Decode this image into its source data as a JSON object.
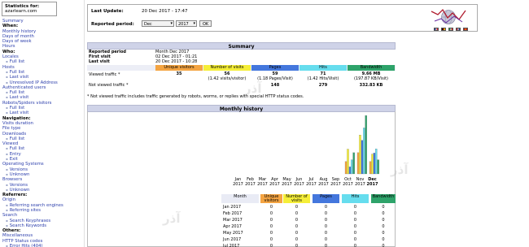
{
  "sidebar": {
    "title": "Statistics for:",
    "site": "azarlearn.com",
    "items": [
      {
        "label": "Summary",
        "kind": "l"
      },
      {
        "label": "When:",
        "kind": "h"
      },
      {
        "label": "Monthly history",
        "kind": "l"
      },
      {
        "label": "Days of month",
        "kind": "l"
      },
      {
        "label": "Days of week",
        "kind": "l"
      },
      {
        "label": "Hours",
        "kind": "l"
      },
      {
        "label": "Who:",
        "kind": "h"
      },
      {
        "label": "Locales",
        "kind": "l"
      },
      {
        "label": "Full list",
        "kind": "sub"
      },
      {
        "label": "Hosts",
        "kind": "l"
      },
      {
        "label": "Full list",
        "kind": "sub"
      },
      {
        "label": "Last visit",
        "kind": "sub"
      },
      {
        "label": "Unresolved IP Address",
        "kind": "sub"
      },
      {
        "label": "Authenticated users",
        "kind": "l"
      },
      {
        "label": "Full list",
        "kind": "sub"
      },
      {
        "label": "Last visit",
        "kind": "sub"
      },
      {
        "label": "Robots/Spiders visitors",
        "kind": "l"
      },
      {
        "label": "Full list",
        "kind": "sub"
      },
      {
        "label": "Last visit",
        "kind": "sub"
      },
      {
        "label": "Navigation:",
        "kind": "h"
      },
      {
        "label": "Visits duration",
        "kind": "l"
      },
      {
        "label": "File type",
        "kind": "l"
      },
      {
        "label": "Downloads",
        "kind": "l"
      },
      {
        "label": "Full list",
        "kind": "sub"
      },
      {
        "label": "Viewed",
        "kind": "l"
      },
      {
        "label": "Full list",
        "kind": "sub"
      },
      {
        "label": "Entry",
        "kind": "sub"
      },
      {
        "label": "Exit",
        "kind": "sub"
      },
      {
        "label": "Operating Systems",
        "kind": "l"
      },
      {
        "label": "Versions",
        "kind": "sub"
      },
      {
        "label": "Unknown",
        "kind": "sub"
      },
      {
        "label": "Browsers",
        "kind": "l"
      },
      {
        "label": "Versions",
        "kind": "sub"
      },
      {
        "label": "Unknown",
        "kind": "sub"
      },
      {
        "label": "Referrers:",
        "kind": "h"
      },
      {
        "label": "Origin",
        "kind": "l"
      },
      {
        "label": "Referring search engines",
        "kind": "sub"
      },
      {
        "label": "Referring sites",
        "kind": "sub"
      },
      {
        "label": "Search",
        "kind": "l"
      },
      {
        "label": "Search Keyphrases",
        "kind": "sub"
      },
      {
        "label": "Search Keywords",
        "kind": "sub"
      },
      {
        "label": "Others:",
        "kind": "h"
      },
      {
        "label": "Miscellaneous",
        "kind": "l"
      },
      {
        "label": "HTTP Status codes",
        "kind": "l"
      },
      {
        "label": "Error Hits (404)",
        "kind": "sub"
      }
    ]
  },
  "header": {
    "last_update_label": "Last Update:",
    "last_update_value": "20 Dec 2017 - 17:47",
    "reported_period_label": "Reported period:",
    "month_value": "Dec",
    "year_value": "2017",
    "ok_label": "OK"
  },
  "flags": [
    {
      "name": "flag-fr",
      "c1": "#1f3a93",
      "c2": "#ffffff",
      "c3": "#d4262e"
    },
    {
      "name": "flag-de",
      "c1": "#000000",
      "c2": "#d40000",
      "c3": "#ffce00"
    },
    {
      "name": "flag-it",
      "c1": "#1a8a3a",
      "c2": "#ffffff",
      "c3": "#d4262e"
    },
    {
      "name": "flag-nl",
      "c1": "#ae1c28",
      "c2": "#ffffff",
      "c3": "#21468b"
    },
    {
      "name": "flag-es",
      "c1": "#c60b1e",
      "c2": "#ffc400",
      "c3": "#c60b1e"
    }
  ],
  "summary": {
    "title": "Summary",
    "reported_period_label": "Reported period",
    "reported_period_value": "Month Dec 2017",
    "first_visit_label": "First visit",
    "first_visit_value": "02 Dec 2017 - 01:21",
    "last_visit_label": "Last visit",
    "last_visit_value": "20 Dec 2017 - 10:28",
    "columns": [
      {
        "label": "Unique visitors",
        "color": "#f4a442"
      },
      {
        "label": "Number of visits",
        "color": "#f5ee38"
      },
      {
        "label": "Pages",
        "color": "#4477dd"
      },
      {
        "label": "Hits",
        "color": "#66ddee"
      },
      {
        "label": "Bandwidth",
        "color": "#2ea36a"
      }
    ],
    "viewed_label": "Viewed traffic *",
    "viewed": [
      "35",
      "56",
      "59",
      "71",
      "9.66 MB"
    ],
    "viewed_sub": [
      "",
      "(1.42 visits/visitor)",
      "(1.18 Pages/Visit)",
      "(1.42 Hits/Visit)",
      "(197.87 KB/Visit)"
    ],
    "not_viewed_label": "Not viewed traffic *",
    "not_viewed": [
      "",
      "",
      "148",
      "279",
      "332.83 KB"
    ],
    "note": "* Not viewed traffic includes traffic generated by robots, worms, or replies with special HTTP status codes."
  },
  "monthly": {
    "title": "Monthly history",
    "months": [
      "Jan",
      "Feb",
      "Mar",
      "Apr",
      "May",
      "Jun",
      "Jul",
      "Aug",
      "Sep",
      "Oct",
      "Nov",
      "Dec"
    ],
    "year": "2017",
    "chart_data": {
      "type": "bar",
      "categories": [
        "Jan 2017",
        "Feb 2017",
        "Mar 2017",
        "Apr 2017",
        "May 2017",
        "Jun 2017",
        "Jul 2017",
        "Aug 2017",
        "Sep 2017",
        "Oct 2017",
        "Nov 2017",
        "Dec 2017"
      ],
      "series": [
        {
          "name": "Unique visitors",
          "color": "#f4a442",
          "values": [
            0,
            0,
            0,
            0,
            0,
            0,
            0,
            0,
            0,
            35,
            60,
            35
          ]
        },
        {
          "name": "Number of visits",
          "color": "#f5ee38",
          "values": [
            0,
            0,
            0,
            0,
            0,
            0,
            0,
            0,
            0,
            70,
            110,
            56
          ]
        },
        {
          "name": "Pages",
          "color": "#4477dd",
          "values": [
            0,
            0,
            0,
            0,
            0,
            0,
            0,
            0,
            0,
            20,
            95,
            59
          ]
        },
        {
          "name": "Hits",
          "color": "#66ddee",
          "values": [
            0,
            0,
            0,
            0,
            0,
            0,
            0,
            0,
            0,
            40,
            130,
            71
          ]
        },
        {
          "name": "Bandwidth",
          "color": "#2ea36a",
          "values": [
            0,
            0,
            0,
            0,
            0,
            0,
            0,
            0,
            0,
            60,
            165,
            40
          ]
        }
      ]
    },
    "table_header": [
      "Month",
      "Unique visitors",
      "Number of visits",
      "Pages",
      "Hits",
      "Bandwidth"
    ],
    "rows": [
      [
        "Jan 2017",
        "0",
        "0",
        "0",
        "0",
        "0"
      ],
      [
        "Feb 2017",
        "0",
        "0",
        "0",
        "0",
        "0"
      ],
      [
        "Mar 2017",
        "0",
        "0",
        "0",
        "0",
        "0"
      ],
      [
        "Apr 2017",
        "0",
        "0",
        "0",
        "0",
        "0"
      ],
      [
        "May 2017",
        "0",
        "0",
        "0",
        "0",
        "0"
      ],
      [
        "Jun 2017",
        "0",
        "0",
        "0",
        "0",
        "0"
      ],
      [
        "Jul 2017",
        "0",
        "0",
        "0",
        "0",
        "0"
      ]
    ]
  }
}
